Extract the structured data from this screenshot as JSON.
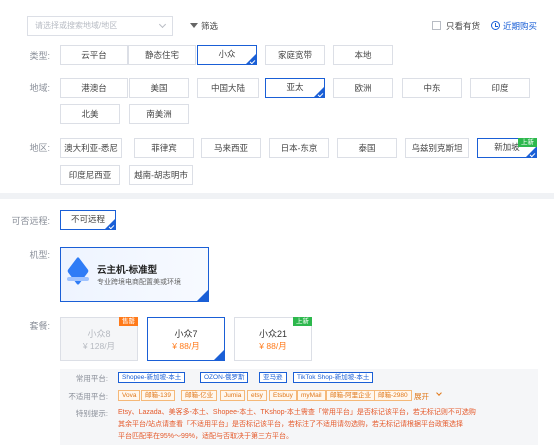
{
  "top": {
    "search_placeholder": "请选择或搜索地域/地区",
    "filter_label": "筛选",
    "instock_label": "只看有货",
    "recent_label": "近期购买"
  },
  "type_row": {
    "label": "类型:",
    "options": [
      "云平台",
      "静态住宅",
      "小众",
      "家庭宽带",
      "本地"
    ],
    "selected": "小众"
  },
  "region_row": {
    "label": "地域:",
    "options": [
      "港澳台",
      "美国",
      "中国大陆",
      "亚太",
      "欧洲",
      "中东",
      "印度",
      "北美",
      "南美洲"
    ],
    "selected": "亚太"
  },
  "area_row": {
    "label": "地区:",
    "options": [
      "澳大利亚-悉尼",
      "菲律宾",
      "马来西亚",
      "日本-东京",
      "泰国",
      "乌兹别克斯坦",
      "新加坡",
      "印度尼西亚",
      "越南-胡志明市"
    ],
    "selected": "新加坡",
    "new_badge": "上新"
  },
  "remote_row": {
    "label": "可否远程:",
    "option": "不可远程"
  },
  "machine_row": {
    "label": "机型:",
    "title": "云主机-标准型",
    "desc": "专业跨境电商配置美或环境"
  },
  "plan_row": {
    "label": "套餐:",
    "plans": [
      {
        "name": "小众8",
        "price": "¥ 128/月",
        "badge": "售罄"
      },
      {
        "name": "小众7",
        "price": "¥ 88/月",
        "badge": ""
      },
      {
        "name": "小众21",
        "price": "¥ 88/月",
        "badge": "上新"
      }
    ]
  },
  "info": {
    "common_label": "常用平台:",
    "common_tags": [
      "Shopee-新加坡-本土",
      "OZON-俄罗斯",
      "亚马逊",
      "TikTok Shop-新加坡-本土"
    ],
    "unsuitable_label": "不适用平台:",
    "unsuitable_tags": [
      "Vova",
      "邮箱-139",
      "邮箱-亿业",
      "Jumia",
      "etsy",
      "Etsbuy",
      "myMail",
      "邮箱-阿里企业",
      "邮箱-2980"
    ],
    "expand_label": "展开",
    "tip_label": "特别提示:",
    "tip_lines": [
      "Etsy、Lazada、美客多-本土、Shopee-本土、TKshop-本土需查「常用平台」是否标记该平台，若无标记则不可选购",
      "其余平台/站点请查看「不适用平台」是否标记该平台，若标注了不适用请勿选购，若无标记请根据平台政策选择",
      "平台匹配率在95%～99%，适配与否取决于第三方平台。"
    ]
  },
  "colors": {
    "accent": "#1a5fd6",
    "price": "#ff7a1a",
    "new_badge": "#2db84d",
    "soldout_badge": "#ff7a1a",
    "tip_text": "#e55a2b"
  }
}
